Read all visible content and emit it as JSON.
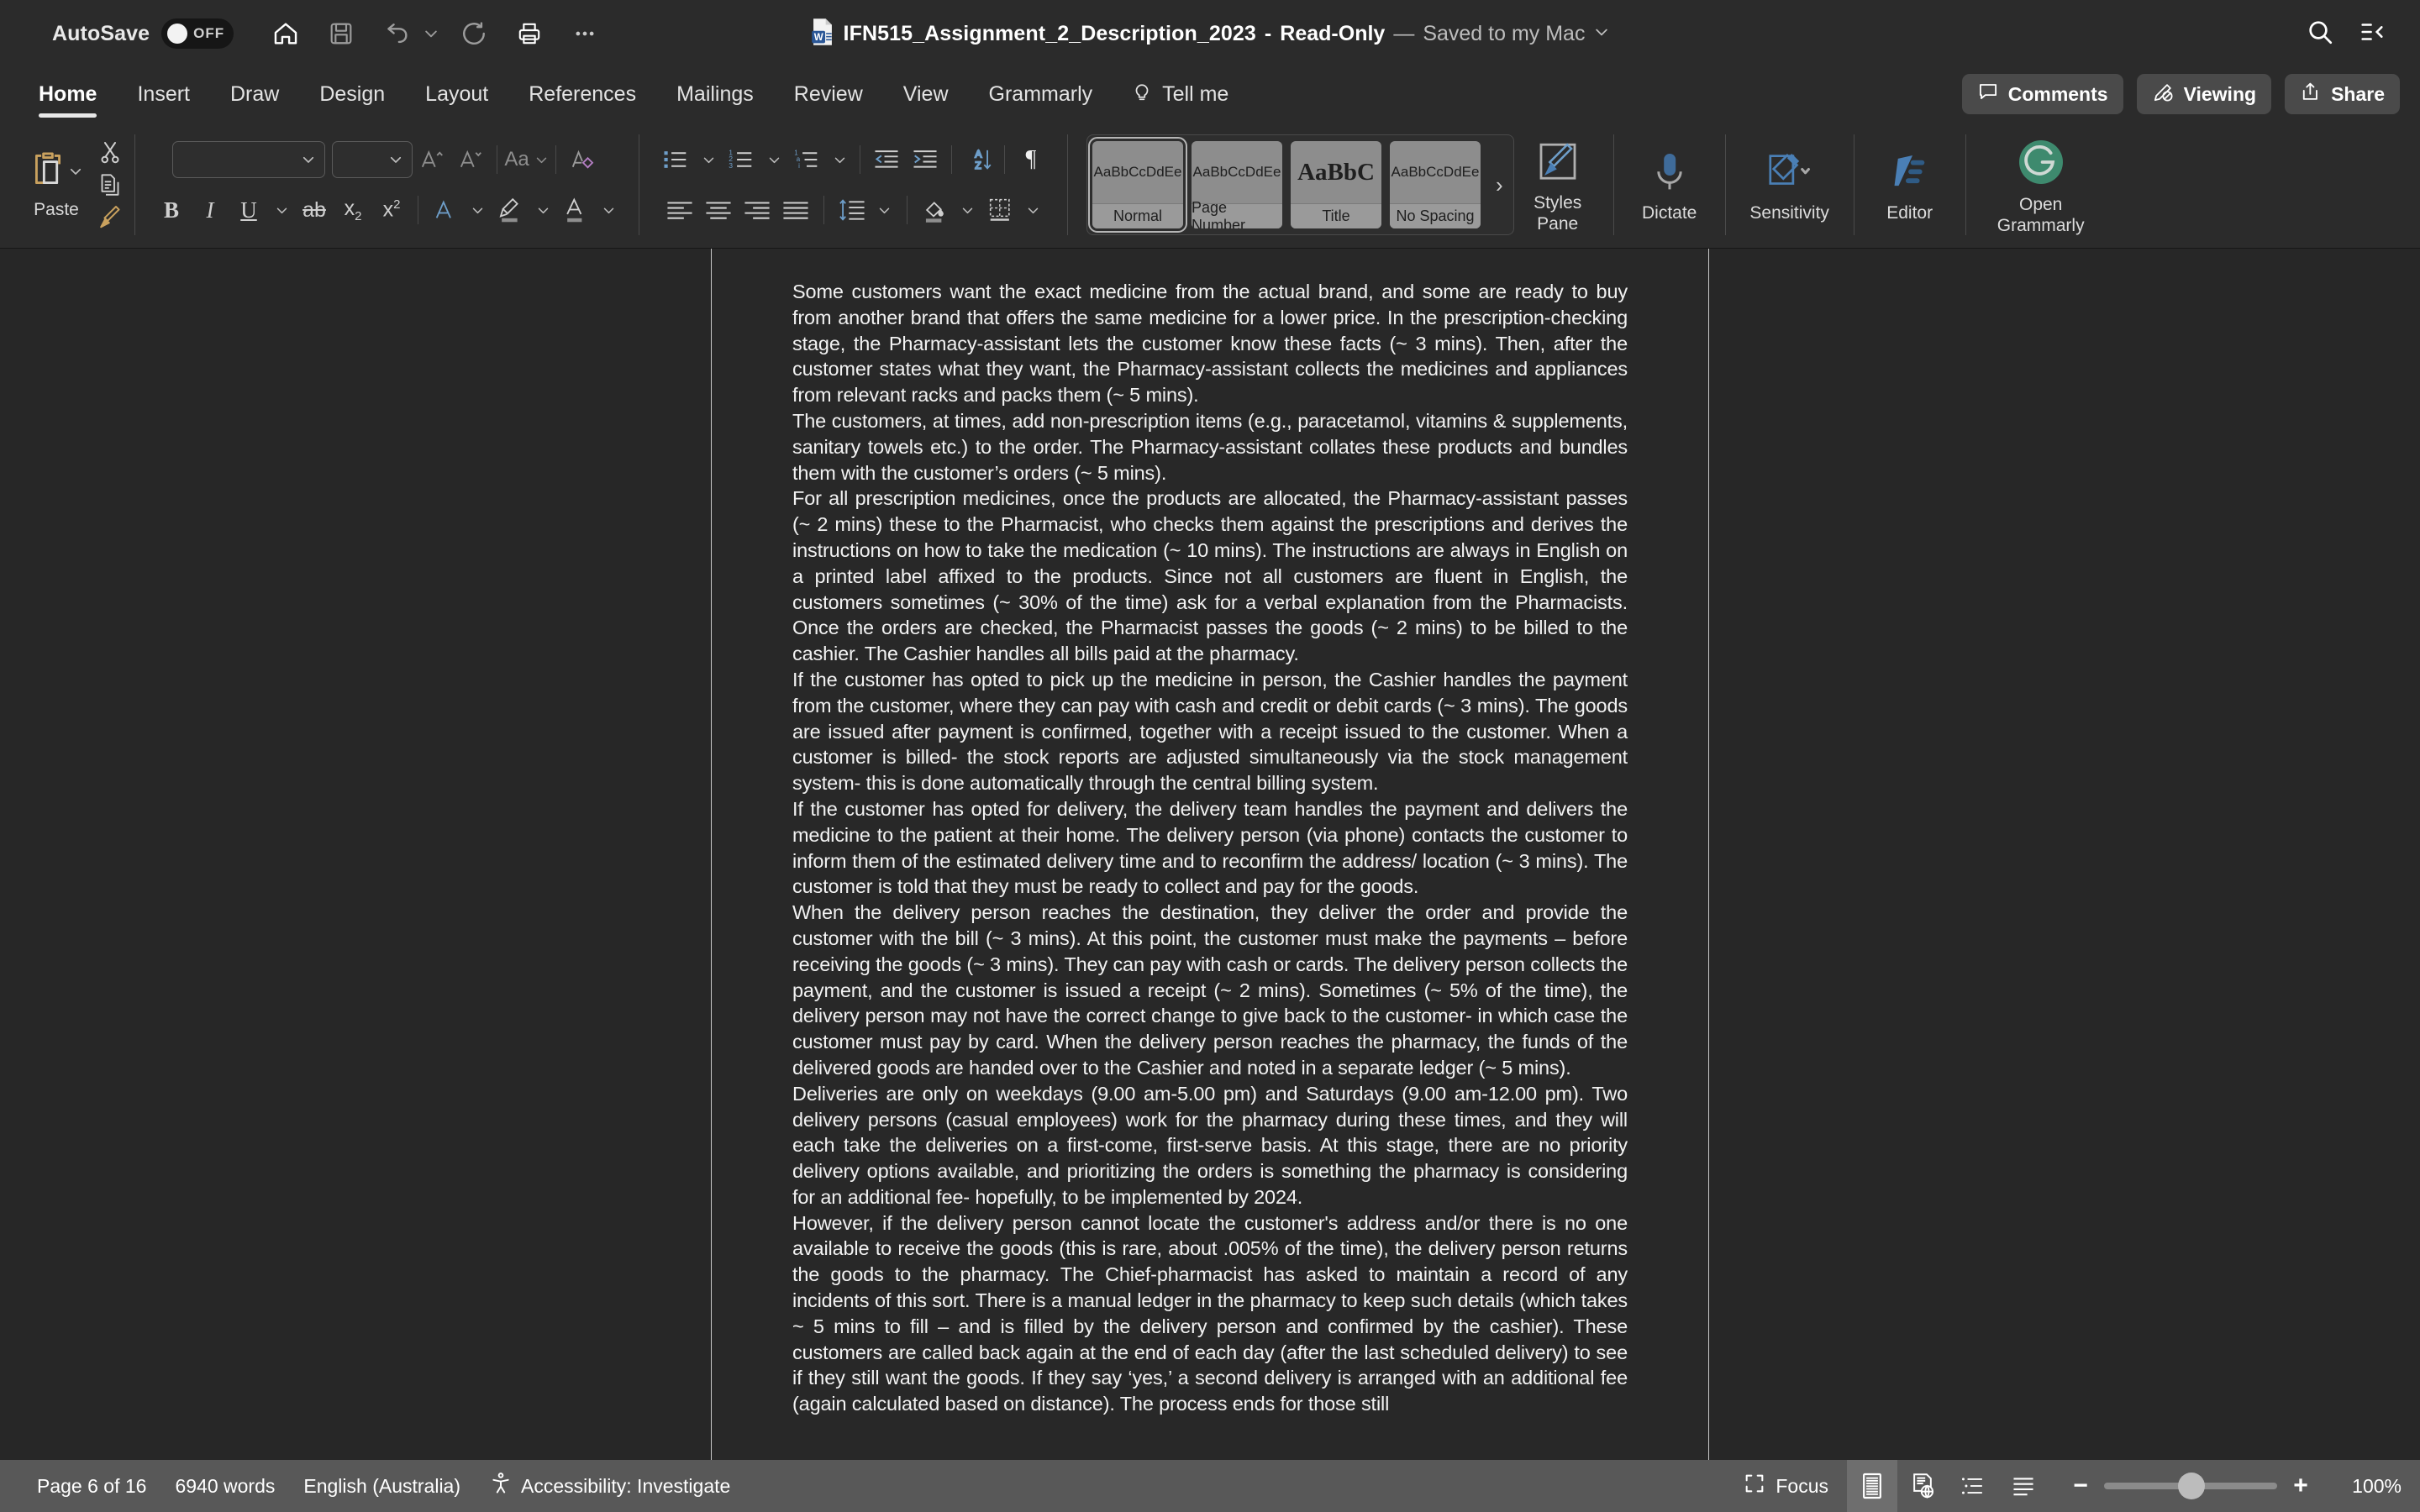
{
  "titlebar": {
    "autosave_label": "AutoSave",
    "autosave_state": "OFF",
    "doc_title": "IFN515_Assignment_2_Description_2023",
    "separator": "-",
    "read_only": "Read-Only",
    "dash": "—",
    "saved_to": "Saved to my Mac",
    "icons": [
      "home-icon",
      "save-icon",
      "undo-icon",
      "undo-chevron-icon",
      "redo-icon",
      "print-icon",
      "more-icon"
    ],
    "right_icons": [
      "search-icon",
      "ribbon-collapse-icon"
    ]
  },
  "tabs": {
    "items": [
      {
        "label": "Home",
        "active": true
      },
      {
        "label": "Insert",
        "active": false
      },
      {
        "label": "Draw",
        "active": false
      },
      {
        "label": "Design",
        "active": false
      },
      {
        "label": "Layout",
        "active": false
      },
      {
        "label": "References",
        "active": false
      },
      {
        "label": "Mailings",
        "active": false
      },
      {
        "label": "Review",
        "active": false
      },
      {
        "label": "View",
        "active": false
      },
      {
        "label": "Grammarly",
        "active": false
      }
    ],
    "tell_me": "Tell me",
    "right_buttons": [
      {
        "label": "Comments",
        "icon": "comment-bubble-icon"
      },
      {
        "label": "Viewing",
        "icon": "pencil-no-edit-icon"
      },
      {
        "label": "Share",
        "icon": "share-arrow-icon"
      }
    ]
  },
  "ribbon": {
    "paste_label": "Paste",
    "font_name": "",
    "font_size": "",
    "styles": [
      {
        "preview": "AaBbCcDdEe",
        "name": "Normal",
        "selected": true,
        "serif": false
      },
      {
        "preview": "AaBbCcDdEe",
        "name": "Page Number",
        "selected": false,
        "serif": false
      },
      {
        "preview": "AaBbC",
        "name": "Title",
        "selected": false,
        "serif": true
      },
      {
        "preview": "AaBbCcDdEe",
        "name": "No Spacing",
        "selected": false,
        "serif": false
      }
    ],
    "gallery_more": "›",
    "styles_pane": "Styles\nPane",
    "styles_pane_l1": "Styles",
    "styles_pane_l2": "Pane",
    "dictate": "Dictate",
    "sensitivity": "Sensitivity",
    "editor": "Editor",
    "grammarly_l1": "Open",
    "grammarly_l2": "Grammarly",
    "grammarly_color": "#3e8a6e"
  },
  "document": {
    "paragraphs": [
      "Some customers want the exact medicine from the actual brand, and some are ready to buy from another brand that offers the same medicine for a lower price. In the prescription-checking stage, the Pharmacy-assistant lets the customer know these facts (~ 3 mins). Then, after the customer states what they want, the Pharmacy-assistant collects the medicines and appliances from relevant racks and packs them (~ 5 mins).",
      "The customers, at times, add non-prescription items (e.g., paracetamol, vitamins & supplements, sanitary towels etc.) to the order. The Pharmacy-assistant collates these products and bundles them with the customer’s orders (~ 5 mins).",
      "For all prescription medicines, once the products are allocated, the Pharmacy-assistant passes (~ 2 mins) these to the Pharmacist, who checks them against the prescriptions and derives the instructions on how to take the medication (~ 10 mins). The instructions are always in English on a printed label affixed to the products. Since not all customers are fluent in English, the customers sometimes (~ 30% of the time) ask for a verbal explanation from the Pharmacists. Once the orders are checked, the Pharmacist passes the goods (~ 2 mins) to be billed to the cashier. The Cashier handles all bills paid at the pharmacy.",
      "If the customer has opted to pick up the medicine in person, the Cashier handles the payment from the customer, where they can pay with cash and credit or debit cards (~ 3 mins). The goods are issued after payment is confirmed, together with a receipt issued to the customer. When a customer is billed- the stock reports are adjusted simultaneously via the stock management system- this is done automatically through the central billing system.",
      "If the customer has opted for delivery, the delivery team handles the payment and delivers the medicine to the patient at their home. The delivery person (via phone) contacts the customer to inform them of the estimated delivery time and to reconfirm the address/ location (~ 3 mins). The customer is told that they must be ready to collect and pay for the goods.",
      "When the delivery person reaches the destination, they deliver the order and provide the customer with the bill (~ 3 mins). At this point, the customer must make the payments – before receiving the goods (~ 3 mins). They can pay with cash or cards. The delivery person collects the payment, and the customer is issued a receipt (~ 2 mins). Sometimes (~ 5% of the time), the delivery person may not have the correct change to give back to the customer- in which case the customer must pay by card. When the delivery person reaches the pharmacy, the funds of the delivered goods are handed over to the Cashier and noted in a separate ledger (~ 5 mins).",
      "Deliveries are only on weekdays (9.00 am-5.00 pm) and Saturdays (9.00 am-12.00 pm). Two delivery persons (casual employees) work for the pharmacy during these times, and they will each take the deliveries on a first-come, first-serve basis. At this stage, there are no priority delivery options available, and prioritizing the orders is something the pharmacy is considering for an additional fee- hopefully, to be implemented by 2024.",
      "However, if the delivery person cannot locate the customer's address and/or there is no one available to receive the goods (this is rare, about .005% of the time), the delivery person returns the goods to the pharmacy. The Chief-pharmacist has asked to maintain a record of any incidents of this sort. There is a manual ledger in the pharmacy to keep such details (which takes ~ 5 mins to fill – and is filled by the delivery person and confirmed by the cashier). These customers are called back again at the end of each day (after the last scheduled delivery) to see if they still want the goods. If they say ‘yes,’ a second delivery is arranged with an additional fee (again calculated based on distance). The process ends for those still"
    ]
  },
  "statusbar": {
    "page": "Page 6 of 16",
    "words": "6940 words",
    "language": "English (Australia)",
    "accessibility": "Accessibility: Investigate",
    "focus": "Focus",
    "zoom_minus": "−",
    "zoom_plus": "+",
    "zoom_level": "100%",
    "view_buttons": [
      "print-layout-icon",
      "web-layout-icon",
      "outline-icon",
      "draft-icon"
    ]
  }
}
